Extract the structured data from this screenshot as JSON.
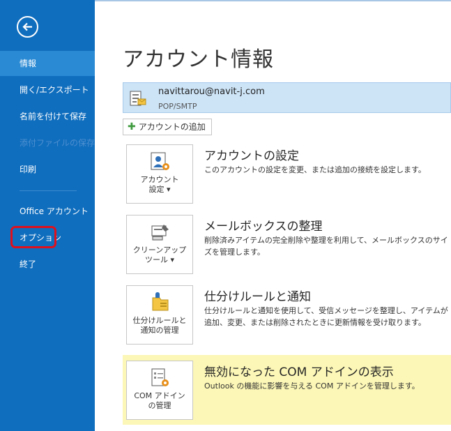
{
  "sidebar": {
    "items": [
      {
        "label": "情報",
        "state": "active"
      },
      {
        "label": "開く/エクスポート",
        "state": "normal"
      },
      {
        "label": "名前を付けて保存",
        "state": "normal"
      },
      {
        "label": "添付ファイルの保存",
        "state": "disabled"
      },
      {
        "label": "印刷",
        "state": "normal"
      },
      {
        "label": "Office アカウント",
        "state": "normal"
      },
      {
        "label": "オプション",
        "state": "highlighted"
      },
      {
        "label": "終了",
        "state": "normal"
      }
    ]
  },
  "page": {
    "title": "アカウント情報",
    "account": {
      "email": "navittarou@navit-j.com",
      "type": "POP/SMTP"
    },
    "add_account_label": "アカウントの追加"
  },
  "sections": [
    {
      "button_label": "アカウント\n設定 ▾",
      "title": "アカウントの設定",
      "description": "このアカウントの設定を変更、または追加の接続を設定します。",
      "icon": "account-settings-icon"
    },
    {
      "button_label": "クリーンアップ\nツール ▾",
      "title": "メールボックスの整理",
      "description": "削除済みアイテムの完全削除や整理を利用して、メールボックスのサイズを管理します。",
      "icon": "cleanup-tools-icon"
    },
    {
      "button_label": "仕分けルールと\n通知の管理",
      "title": "仕分けルールと通知",
      "description": "仕分けルールと通知を使用して、受信メッセージを整理し、アイテムが追加、変更、または削除されたときに更新情報を受け取ります。",
      "icon": "rules-alerts-icon"
    },
    {
      "button_label": "COM アドイン\nの管理",
      "title": "無効になった COM アドインの表示",
      "description": "Outlook の機能に影響を与える COM アドインを管理します。",
      "icon": "com-addins-icon"
    }
  ],
  "colors": {
    "sidebar": "#106ebe",
    "sidebar_active": "#2a8ad4",
    "account_bg": "#cde4f7",
    "com_band": "#fcf7b6",
    "highlight_border": "#e0101c"
  }
}
